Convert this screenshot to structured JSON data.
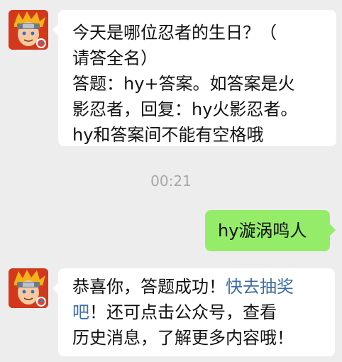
{
  "chat": {
    "messages": [
      {
        "sender": "bot",
        "lines": [
          "今天是哪位忍者的生日？（",
          "请答全名）",
          "答题：hy+答案。如答案是火",
          "影忍者，回复：hy火影忍者。",
          "hy和答案间不能有空格哦"
        ]
      },
      {
        "sender": "user",
        "text": "hy漩涡鸣人"
      },
      {
        "sender": "bot",
        "line1_text": "恭喜你，答题成功！",
        "line1_link": "快去抽奖",
        "line2_link": "吧",
        "line2_text": "！还可点击公众号，查看",
        "line3_text": "历史消息，了解更多内容哦！"
      }
    ],
    "timestamp": "00:21"
  },
  "colors": {
    "background": "#ededed",
    "bot_bubble": "#ffffff",
    "user_bubble": "#95ec69",
    "link": "#3b6ea5"
  }
}
